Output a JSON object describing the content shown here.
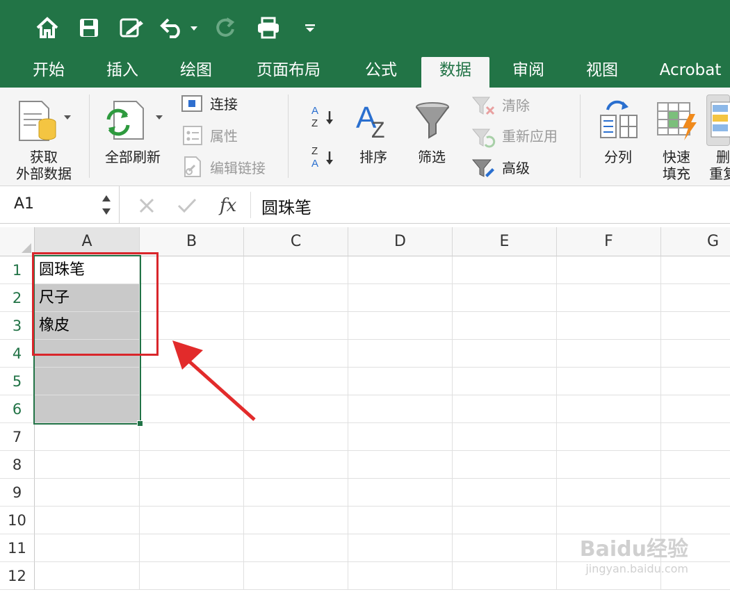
{
  "tabs": [
    "开始",
    "插入",
    "绘图",
    "页面布局",
    "公式",
    "数据",
    "审阅",
    "视图",
    "Acrobat"
  ],
  "active_tab": "数据",
  "ribbon": {
    "get_external_data": [
      "获取",
      "外部数据"
    ],
    "refresh_all": "全部刷新",
    "connections": "连接",
    "properties": "属性",
    "edit_links": "编辑链接",
    "sort": "排序",
    "filter": "筛选",
    "clear": "清除",
    "reapply": "重新应用",
    "advanced": "高级",
    "text_to_columns": "分列",
    "flash_fill": [
      "快速",
      "填充"
    ],
    "remove_duplicates": [
      "删",
      "重复"
    ]
  },
  "formula_bar": {
    "name_box": "A1",
    "formula": "圆珠笔"
  },
  "sheet": {
    "columns": [
      "A",
      "B",
      "C",
      "D",
      "E",
      "F",
      "G"
    ],
    "rows": [
      "1",
      "2",
      "3",
      "4",
      "5",
      "6",
      "7",
      "8",
      "9",
      "10",
      "11",
      "12"
    ],
    "cells_A": [
      "圆珠笔",
      "尺子",
      "橡皮",
      "",
      "",
      ""
    ]
  },
  "colors": {
    "excel_green": "#227446",
    "selection": "#217346",
    "annotation_red": "#d9262b"
  },
  "watermark": {
    "logo": "Baidu经验",
    "url": "jingyan.baidu.com"
  }
}
